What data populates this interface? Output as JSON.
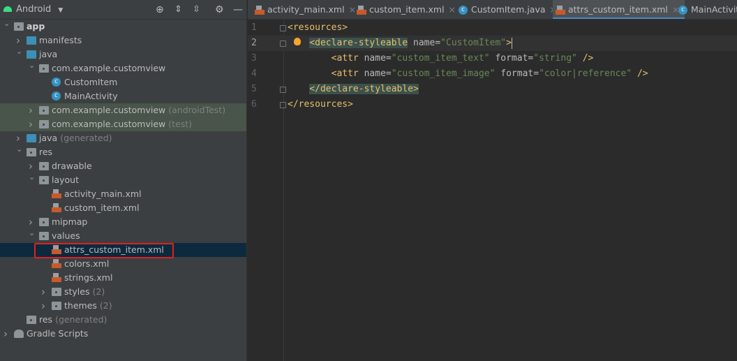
{
  "project": {
    "view_label": "Android",
    "toolbar_icons": [
      "locate-icon",
      "expand-all-icon",
      "collapse-all-icon",
      "gear-icon",
      "minimize-icon"
    ],
    "tree": [
      {
        "label": "app",
        "level": 0,
        "state": "open",
        "icon": "module",
        "bold": true
      },
      {
        "label": "manifests",
        "level": 1,
        "state": "closed",
        "icon": "folder"
      },
      {
        "label": "java",
        "level": 1,
        "state": "open",
        "icon": "folder"
      },
      {
        "label": "com.example.customview",
        "level": 2,
        "state": "open",
        "icon": "package"
      },
      {
        "label": "CustomItem",
        "level": 3,
        "state": "leaf",
        "icon": "class"
      },
      {
        "label": "MainActivity",
        "level": 3,
        "state": "leaf",
        "icon": "class"
      },
      {
        "label": "com.example.customview",
        "secondary": "(androidTest)",
        "level": 2,
        "state": "closed",
        "icon": "package",
        "test": true
      },
      {
        "label": "com.example.customview",
        "secondary": "(test)",
        "level": 2,
        "state": "closed",
        "icon": "package",
        "test": true
      },
      {
        "label": "java",
        "secondary": "(generated)",
        "level": 1,
        "state": "closed",
        "icon": "folder"
      },
      {
        "label": "res",
        "level": 1,
        "state": "open",
        "icon": "res"
      },
      {
        "label": "drawable",
        "level": 2,
        "state": "closed",
        "icon": "package"
      },
      {
        "label": "layout",
        "level": 2,
        "state": "open",
        "icon": "package"
      },
      {
        "label": "activity_main.xml",
        "level": 3,
        "state": "leaf",
        "icon": "xml"
      },
      {
        "label": "custom_item.xml",
        "level": 3,
        "state": "leaf",
        "icon": "xml"
      },
      {
        "label": "mipmap",
        "level": 2,
        "state": "closed",
        "icon": "package"
      },
      {
        "label": "values",
        "level": 2,
        "state": "open",
        "icon": "package"
      },
      {
        "label": "attrs_custom_item.xml",
        "level": 3,
        "state": "leaf",
        "icon": "xml",
        "selected": true
      },
      {
        "label": "colors.xml",
        "level": 3,
        "state": "leaf",
        "icon": "xml"
      },
      {
        "label": "strings.xml",
        "level": 3,
        "state": "leaf",
        "icon": "xml"
      },
      {
        "label": "styles",
        "secondary": "(2)",
        "level": 3,
        "state": "closed",
        "icon": "package"
      },
      {
        "label": "themes",
        "secondary": "(2)",
        "level": 3,
        "state": "closed",
        "icon": "package"
      },
      {
        "label": "res",
        "secondary": "(generated)",
        "level": 1,
        "state": "none",
        "icon": "res"
      },
      {
        "label": "Gradle Scripts",
        "level": 0,
        "state": "closed",
        "icon": "gradle"
      }
    ]
  },
  "tabs": [
    {
      "label": "activity_main.xml",
      "icon": "xml"
    },
    {
      "label": "custom_item.xml",
      "icon": "xml"
    },
    {
      "label": "CustomItem.java",
      "icon": "class"
    },
    {
      "label": "attrs_custom_item.xml",
      "icon": "xml",
      "active": true
    },
    {
      "label": "MainActivity",
      "icon": "class"
    }
  ],
  "editor": {
    "current_line": 2,
    "lines": [
      {
        "n": "1",
        "parts": [
          [
            "tg",
            "<resources>"
          ]
        ]
      },
      {
        "n": "2",
        "parts": [
          [
            "ind",
            "    "
          ],
          [
            "tg hl",
            "<declare-styleable"
          ],
          [
            "an",
            " name="
          ],
          [
            "av",
            "\"CustomItem\""
          ],
          [
            "tg",
            ">"
          ]
        ]
      },
      {
        "n": "3",
        "parts": [
          [
            "ind",
            "        "
          ],
          [
            "tg",
            "<attr"
          ],
          [
            "an",
            " name="
          ],
          [
            "av",
            "\"custom_item_text\""
          ],
          [
            "an",
            " format="
          ],
          [
            "av",
            "\"string\""
          ],
          [
            "tg",
            " />"
          ]
        ]
      },
      {
        "n": "4",
        "parts": [
          [
            "ind",
            "        "
          ],
          [
            "tg",
            "<attr"
          ],
          [
            "an",
            " name="
          ],
          [
            "av",
            "\"custom_item_image\""
          ],
          [
            "an",
            " format="
          ],
          [
            "av",
            "\"color|reference\""
          ],
          [
            "tg",
            " />"
          ]
        ]
      },
      {
        "n": "5",
        "parts": [
          [
            "ind",
            "    "
          ],
          [
            "tg hl",
            "</declare-styleable>"
          ]
        ]
      },
      {
        "n": "6",
        "parts": [
          [
            "tg",
            "</resources>"
          ]
        ]
      }
    ]
  },
  "colors": {
    "accent": "#4a88c7",
    "selection": "#0d293e",
    "highlight_box": "#e0211d",
    "android_green": "#3ddc84"
  }
}
